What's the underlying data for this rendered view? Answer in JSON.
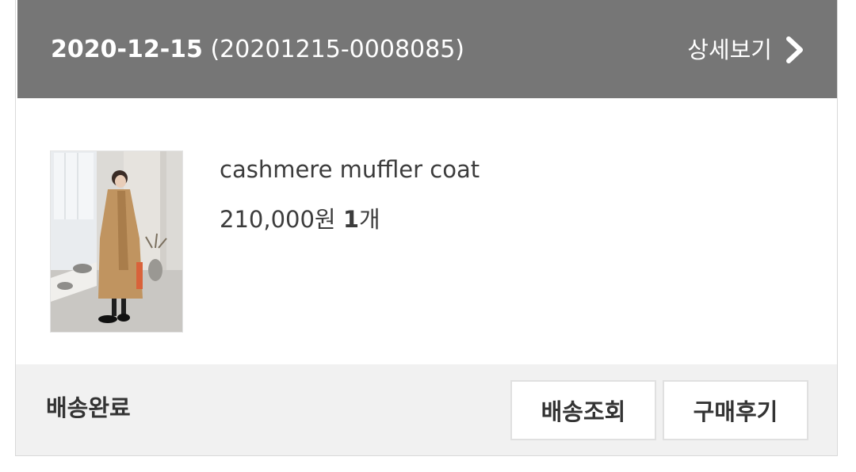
{
  "order": {
    "date": "2020-12-15",
    "number": "(20201215-0008085)",
    "detail_label": "상세보기",
    "detail_icon": "chevron-right-icon"
  },
  "product": {
    "name": "cashmere muffler coat",
    "price": "210,000원",
    "quantity_number": "1",
    "quantity_unit": "개",
    "image_alt": "camel cashmere coat with muffler"
  },
  "footer": {
    "status": "배송완료",
    "track_button": "배송조회",
    "review_button": "구매후기"
  },
  "colors": {
    "header_bg": "#767676",
    "footer_bg": "#f1f1f1",
    "text": "#3c3c3c"
  }
}
